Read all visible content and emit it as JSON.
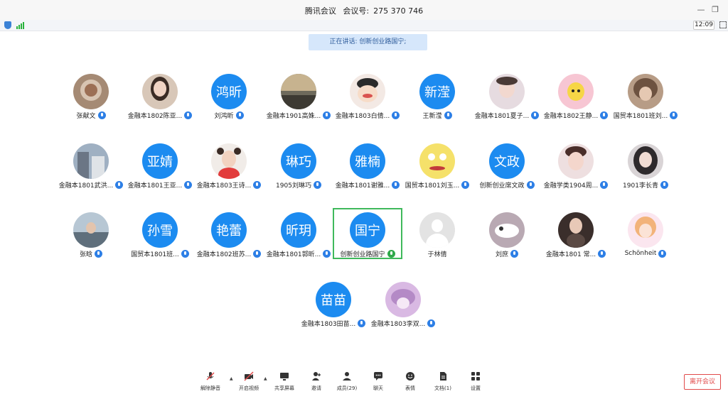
{
  "window": {
    "app_name": "腾讯会议",
    "meeting_id_label": "会议号:",
    "meeting_id": "275 370 746"
  },
  "statusbar": {
    "time": "12:09"
  },
  "speaking_banner": "正在讲话: 创新创业路国宁;",
  "participants": [
    {
      "name": "张献文",
      "avatar": "photo"
    },
    {
      "name": "金融本1802陈亚...",
      "avatar": "photo"
    },
    {
      "name": "刘鸿昕",
      "avatar_text": "鸿昕"
    },
    {
      "name": "金融本1901高姝...",
      "avatar": "photo"
    },
    {
      "name": "金融本1803白倩...",
      "avatar": "photo"
    },
    {
      "name": "王新滢",
      "avatar_text": "新滢"
    },
    {
      "name": "金融本1801夏子...",
      "avatar": "photo"
    },
    {
      "name": "金融本1802王静...",
      "avatar": "photo"
    },
    {
      "name": "国贸本1801班刘...",
      "avatar": "photo"
    },
    {
      "name": "金融本1801武洪...",
      "avatar": "photo"
    },
    {
      "name": "金融本1801王亚...",
      "avatar_text": "亚婧"
    },
    {
      "name": "金融本1803王诗...",
      "avatar": "photo"
    },
    {
      "name": "1905刘琳巧",
      "avatar_text": "琳巧"
    },
    {
      "name": "金融本1801谢雅...",
      "avatar_text": "雅楠"
    },
    {
      "name": "国贸本1801刘玉...",
      "avatar": "photo"
    },
    {
      "name": "创新创业席文政",
      "avatar_text": "文政"
    },
    {
      "name": "金融学类1904周...",
      "avatar": "photo"
    },
    {
      "name": "1901李长青",
      "avatar": "photo"
    },
    {
      "name": "张晗",
      "avatar": "photo"
    },
    {
      "name": "国贸本1801班...",
      "avatar_text": "孙雪"
    },
    {
      "name": "金融本1802班苏...",
      "avatar_text": "艳蕾"
    },
    {
      "name": "金融本1801郭昕...",
      "avatar_text": "昕玥"
    },
    {
      "name": "创新创业路国宁",
      "avatar_text": "国宁",
      "speaking": true
    },
    {
      "name": "于林倩",
      "avatar": "default"
    },
    {
      "name": "刘庶",
      "avatar": "photo"
    },
    {
      "name": "金融本1801 常...",
      "avatar": "photo"
    },
    {
      "name": "Schönheit",
      "avatar": "photo"
    },
    {
      "name": "金融本1803田苗...",
      "avatar_text": "苗苗"
    },
    {
      "name": "金融本1803李双...",
      "avatar": "photo"
    }
  ],
  "toolbar": {
    "mute": "解除静音",
    "video": "开启视频",
    "share": "共享屏幕",
    "invite": "邀请",
    "members": "成员(29)",
    "chat": "聊天",
    "reactions": "表情",
    "docs": "文档(1)",
    "settings": "设置",
    "leave": "离开会议"
  },
  "colors": {
    "accent": "#1c8bf0",
    "active_border": "#3fb95c",
    "leave": "#e14a4a"
  }
}
